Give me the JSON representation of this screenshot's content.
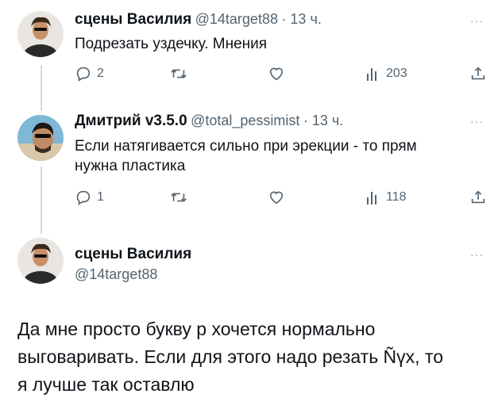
{
  "tweets": [
    {
      "author": "сцены Василия",
      "handle": "@14target88",
      "time": "· 13 ч.",
      "text": "Подрезать уздечку. Мнения",
      "replies": "2",
      "views": "203"
    },
    {
      "author": "Дмитрий v3.5.0",
      "handle": "@total_pessimist",
      "time": "· 13 ч.",
      "text_line1": "Если натягивается сильно при эрекции - то прям",
      "text_line2": "нужна пластика",
      "replies": "1",
      "views": "118"
    }
  ],
  "main_tweet": {
    "author": "сцены Василия",
    "handle": "@14target88",
    "line1": "Да мне просто букву р хочется нормально",
    "line2": "выговаривать. Если для этого надо резать Ñүх, то",
    "line3": "я лучше так оставлю"
  },
  "more_label": "···",
  "colors": {
    "text": "#0f1419",
    "muted": "#536471",
    "thread": "#cfd9de"
  },
  "icons": [
    "reply-icon",
    "retweet-icon",
    "like-icon",
    "views-icon",
    "share-icon"
  ]
}
